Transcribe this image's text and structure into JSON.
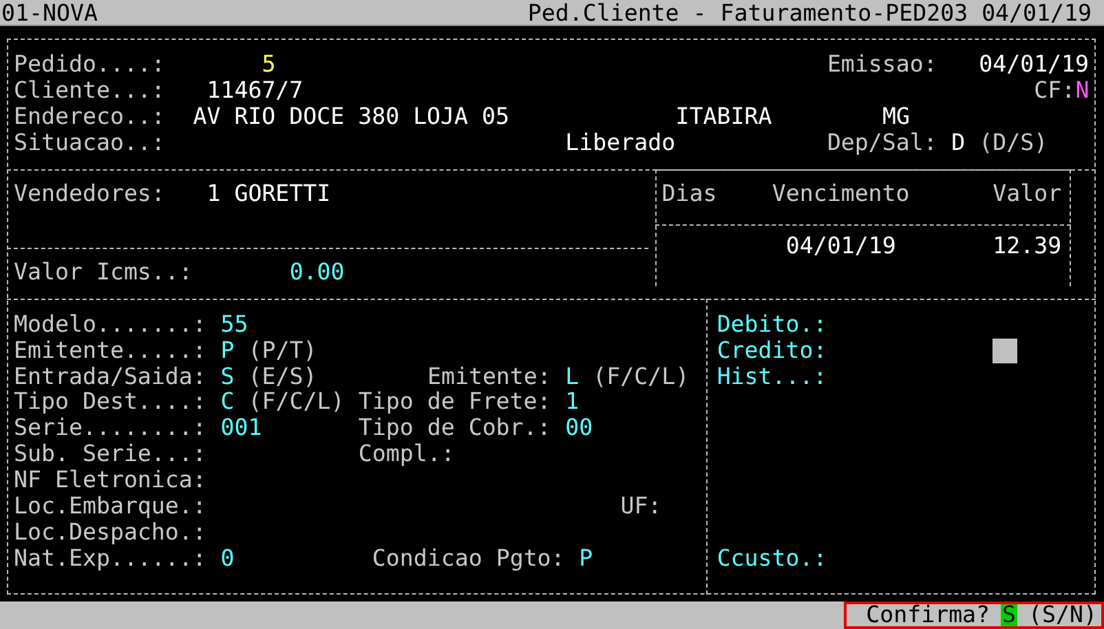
{
  "title_bar": {
    "program": "01-NOVA",
    "title": "Ped.Cliente - Faturamento-PED203 04/01/19"
  },
  "order": [
    {
      "label": "Pedido....:",
      "value": "5",
      "color": "#ffff55"
    },
    {
      "label": "Emissao:",
      "value": "04/01/19",
      "color": "#ffffff"
    },
    {
      "label": "Cliente...:",
      "value": "11467/7",
      "color": "#ffffff"
    },
    {
      "label": "CF:",
      "value": "N",
      "color": "#ff55ff"
    },
    {
      "label": "Endereco..:",
      "value": "AV RIO DOCE 380 LOJA 05",
      "color": "#ffffff"
    },
    {
      "value": "ITABIRA",
      "color": "#ffffff"
    },
    {
      "value": "MG",
      "color": "#ffffff"
    },
    {
      "label": "Situacao..:"
    },
    {
      "value": "Liberado",
      "color": "#ffffff"
    },
    {
      "label": "Dep/Sal:",
      "value": "D",
      "hint": "(D/S)",
      "color": "#ffffff"
    }
  ],
  "sales": {
    "label": "Vendedores:",
    "value": "1 GORETTI"
  },
  "icms": {
    "label": "Valor Icms..:",
    "value": "0.00"
  },
  "installments": {
    "columns": [
      "Dias",
      "Vencimento",
      "Valor"
    ],
    "rows": [
      {
        "vencimento": "04/01/19",
        "valor": "12.39"
      }
    ]
  },
  "fiscal": [
    {
      "label": "Modelo.......:",
      "value": "55"
    },
    {
      "label": "Emitente.....:",
      "value": "P",
      "hint": "(P/T)"
    },
    {
      "label": "Entrada/Saida:",
      "value": "S",
      "hint": "(E/S)"
    },
    {
      "label": "Emitente:",
      "value": "L",
      "hint": "(F/C/L)"
    },
    {
      "label": "Tipo Dest....:",
      "value": "C",
      "hint": "(F/C/L)"
    },
    {
      "label": "Tipo de Frete:",
      "value": "1"
    },
    {
      "label": "Serie........:",
      "value": "001"
    },
    {
      "label": "Tipo de Cobr.:",
      "value": "00"
    },
    {
      "label": "Sub. Serie...:"
    },
    {
      "label": "Compl.:"
    },
    {
      "label": "NF Eletronica:"
    },
    {
      "label": "Loc.Embarque.:"
    },
    {
      "label": "UF:"
    },
    {
      "label": "Loc.Despacho.:"
    },
    {
      "label": "Nat.Exp......:",
      "value": "0"
    },
    {
      "label": "Condicao Pgto:",
      "value": "P"
    }
  ],
  "accounts": [
    {
      "label": "Debito.:"
    },
    {
      "label": "Credito:"
    },
    {
      "label": "Hist...:"
    },
    {
      "label": "Ccusto.:"
    }
  ],
  "status_bar": {
    "prompt": "Confirma?",
    "answer": "S",
    "options": "(S/N)"
  }
}
